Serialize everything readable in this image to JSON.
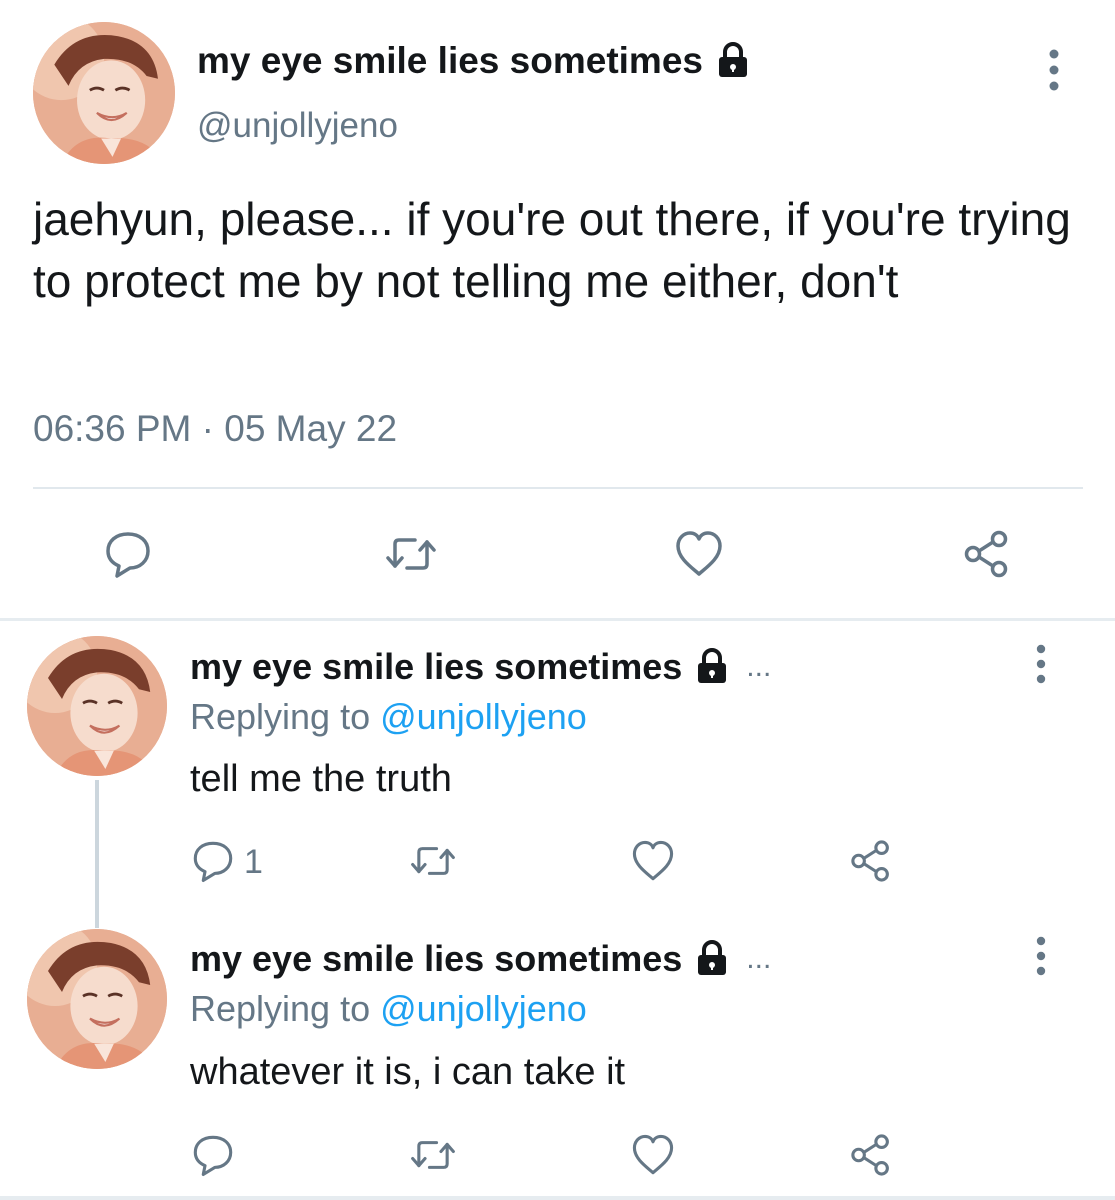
{
  "main_tweet": {
    "display_name": "my eye smile lies sometimes",
    "handle": "@unjollyjeno",
    "text": "jaehyun, please... if you're out there, if you're trying to protect me by not telling me either, don't",
    "timestamp": "06:36 PM · 05 May 22",
    "icons": [
      "lock-icon",
      "more-vertical-icon",
      "reply-icon",
      "retweet-icon",
      "like-icon",
      "share-icon"
    ]
  },
  "replies": [
    {
      "display_name": "my eye smile lies sometimes",
      "ellipsis": "...",
      "replying_prefix": "Replying to ",
      "replying_handle": "@unjollyjeno",
      "text": "tell me the truth",
      "reply_count": "1"
    },
    {
      "display_name": "my eye smile lies sometimes",
      "ellipsis": "...",
      "replying_prefix": "Replying to ",
      "replying_handle": "@unjollyjeno",
      "text": "whatever it is, i can take it",
      "reply_count": ""
    }
  ],
  "colors": {
    "text": "#14171a",
    "secondary": "#657786",
    "link": "#1da1f2",
    "divider": "#e1e8ed"
  }
}
